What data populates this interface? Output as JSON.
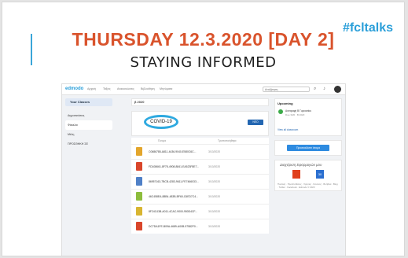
{
  "slide": {
    "hashtag": "#fcltalks",
    "title": "THURSDAY 12.3.2020 [DAY 2]",
    "subtitle": "STAYING INFORMED"
  },
  "edmodo": {
    "logo": "edmodo",
    "nav": [
      "Αρχική",
      "Τάξεις",
      "Ανακοινώσεις",
      "Βιβλιοθήκη",
      "Μηνύματα"
    ],
    "search_placeholder": "Αναζήτηση",
    "left": {
      "your_classes": "Your Classes",
      "items": [
        "Δημοσιεύσεις",
        "Φάκελοι",
        "Μέλη",
        "ΠΡΟΣΘΗΚΗ ΣΕ"
      ]
    },
    "class_header": "β 2020",
    "folder_label": "COVID-19",
    "new_button": "ΝΕΟ",
    "list_headers": [
      "Όνομα",
      "Τροποποιήθηκε"
    ],
    "files": [
      {
        "name": "C0686785-A811-4436-9040-E580C6C...",
        "date": "3/10/2020",
        "color": "#e3a62c"
      },
      {
        "name": "FD108661-8F78-4908-8841-EA523F8E7...",
        "date": "3/10/2020",
        "color": "#d9462b"
      },
      {
        "name": "86957163-7BCB-4283-9611-FE7466033...",
        "date": "3/10/2020",
        "color": "#4f80c7"
      },
      {
        "name": "46C458EA-88B4-483B-BF60-C6ED7C4...",
        "date": "3/10/2020",
        "color": "#8dbd3d"
      },
      {
        "name": "8F24C43B-A011-4CAC-9000-950D4CF...",
        "date": "3/10/2020",
        "color": "#d8b531"
      },
      {
        "name": "DC7DA1FE-B09A-4689-A00B-97582F0...",
        "date": "3/10/2020",
        "color": "#d9462b"
      }
    ],
    "upcoming": {
      "title": "Upcoming",
      "event": "Ανατροφή Β Γυμνασίου",
      "event_sub": "Due 3/20 · Β 2020",
      "view_all": "View all classroom"
    },
    "join_button": "Προσκαλέστε άτομα",
    "apps_title": "Διαχείριση Εφαρμογών μου",
    "calendar_day": "30",
    "footer": "Πολιτική · Προϋποθέσεις · Χρήσεις · Κανόνες · Βοήθεια · Blog · Twitter · Facebook · Edmodo © 2020"
  },
  "colors": {
    "title": "#d9532c",
    "hashtag": "#2b9fd9",
    "accent_line": "#3aa6d9",
    "covid_circle": "#2ea9e0",
    "new_button": "#2366b1"
  }
}
